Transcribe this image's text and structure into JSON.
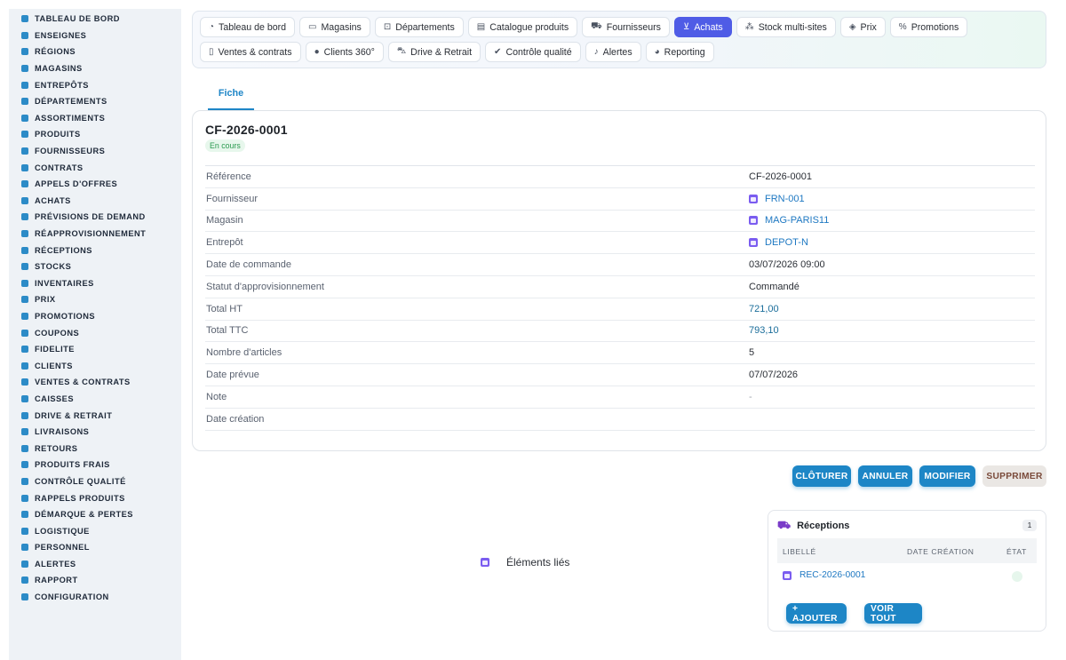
{
  "colors": {
    "accent": "#1d86c6",
    "active_nav": "#4f5ce6",
    "status_green": "#2a9a4f",
    "link": "#1e78c2"
  },
  "sidebar": {
    "items": [
      {
        "label": "TABLEAU DE BORD",
        "icon": "gauge-icon"
      },
      {
        "label": "ENSEIGNES",
        "icon": "flag-icon"
      },
      {
        "label": "RÉGIONS",
        "icon": "map-icon"
      },
      {
        "label": "MAGASINS",
        "icon": "store-icon"
      },
      {
        "label": "ENTREPÔTS",
        "icon": "warehouse-icon"
      },
      {
        "label": "DÉPARTEMENTS",
        "icon": "basket-icon"
      },
      {
        "label": "ASSORTIMENTS",
        "icon": "layers-icon"
      },
      {
        "label": "PRODUITS",
        "icon": "box-icon"
      },
      {
        "label": "FOURNISSEURS",
        "icon": "truck-icon"
      },
      {
        "label": "CONTRATS",
        "icon": "file-icon"
      },
      {
        "label": "APPELS D'OFFRES",
        "icon": "gavel-icon"
      },
      {
        "label": "ACHATS",
        "icon": "cart-icon"
      },
      {
        "label": "PRÉVISIONS DE DEMAND",
        "icon": "chart-icon"
      },
      {
        "label": "RÉAPPROVISIONNEMENT",
        "icon": "refresh-icon"
      },
      {
        "label": "RÉCEPTIONS",
        "icon": "dolly-icon"
      },
      {
        "label": "STOCKS",
        "icon": "cubes-icon"
      },
      {
        "label": "INVENTAIRES",
        "icon": "clipboard-icon"
      },
      {
        "label": "PRIX",
        "icon": "tag-icon"
      },
      {
        "label": "PROMOTIONS",
        "icon": "percent-icon"
      },
      {
        "label": "COUPONS",
        "icon": "ticket-icon"
      },
      {
        "label": "FIDELITE",
        "icon": "card-icon"
      },
      {
        "label": "CLIENTS",
        "icon": "user-icon"
      },
      {
        "label": "VENTES & CONTRATS",
        "icon": "handshake-icon"
      },
      {
        "label": "CAISSES",
        "icon": "register-icon"
      },
      {
        "label": "DRIVE & RETRAIT",
        "icon": "car-icon"
      },
      {
        "label": "LIVRAISONS",
        "icon": "delivery-icon"
      },
      {
        "label": "RETOURS",
        "icon": "undo-icon"
      },
      {
        "label": "PRODUITS FRAIS",
        "icon": "leaf-icon"
      },
      {
        "label": "CONTRÔLE QUALITÉ",
        "icon": "check-double-icon"
      },
      {
        "label": "RAPPELS PRODUITS",
        "icon": "warning-icon"
      },
      {
        "label": "DÉMARQUE & PERTES",
        "icon": "trash-icon"
      },
      {
        "label": "LOGISTIQUE",
        "icon": "route-icon"
      },
      {
        "label": "PERSONNEL",
        "icon": "users-icon"
      },
      {
        "label": "ALERTES",
        "icon": "bell-icon"
      },
      {
        "label": "RAPPORT",
        "icon": "pie-icon"
      },
      {
        "label": "CONFIGURATION",
        "icon": "cog-icon"
      }
    ]
  },
  "topnav": {
    "row1": [
      {
        "label": "Tableau de bord",
        "glyph": "◔",
        "active": false
      },
      {
        "label": "Magasins",
        "glyph": "▭",
        "active": false
      },
      {
        "label": "Départements",
        "glyph": "⊡",
        "active": false
      },
      {
        "label": "Catalogue produits",
        "glyph": "▤",
        "active": false
      },
      {
        "label": "Fournisseurs",
        "glyph": "⛟",
        "active": false
      },
      {
        "label": "Achats",
        "glyph": "⊻",
        "active": true
      },
      {
        "label": "Stock multi-sites",
        "glyph": "⁂",
        "active": false
      },
      {
        "label": "Prix",
        "glyph": "◈",
        "active": false
      },
      {
        "label": "Promotions",
        "glyph": "%",
        "active": false
      }
    ],
    "row2": [
      {
        "label": "Ventes & contrats",
        "glyph": "▯",
        "active": false
      },
      {
        "label": "Clients 360°",
        "glyph": "●",
        "active": false
      },
      {
        "label": "Drive & Retrait",
        "glyph": "⛍",
        "active": false
      },
      {
        "label": "Contrôle qualité",
        "glyph": "✔",
        "active": false
      },
      {
        "label": "Alertes",
        "glyph": "♪",
        "active": false
      },
      {
        "label": "Reporting",
        "glyph": "◕",
        "active": false
      }
    ]
  },
  "tabs": {
    "fiche": "Fiche"
  },
  "record": {
    "title": "CF-2026-0001",
    "status": "En cours",
    "fields": [
      {
        "label": "Référence",
        "value": "CF-2026-0001",
        "kind": "text"
      },
      {
        "label": "Fournisseur",
        "value": "FRN-001",
        "kind": "link"
      },
      {
        "label": "Magasin",
        "value": "MAG-PARIS11",
        "kind": "link"
      },
      {
        "label": "Entrepôt",
        "value": "DEPOT-N",
        "kind": "link"
      },
      {
        "label": "Date de commande",
        "value": "03/07/2026 09:00",
        "kind": "text"
      },
      {
        "label": "Statut d'approvisionnement",
        "value": "Commandé",
        "kind": "text"
      },
      {
        "label": "Total HT",
        "value": "721,00",
        "kind": "num"
      },
      {
        "label": "Total TTC",
        "value": "793,10",
        "kind": "num"
      },
      {
        "label": "Nombre d'articles",
        "value": "5",
        "kind": "text"
      },
      {
        "label": "Date prévue",
        "value": "07/07/2026",
        "kind": "text"
      },
      {
        "label": "Note",
        "value": "-",
        "kind": "muted"
      },
      {
        "label": "Date création",
        "value": "",
        "kind": "text"
      }
    ]
  },
  "actions": {
    "close": "CLÔTURER",
    "cancel": "ANNULER",
    "edit": "MODIFIER",
    "delete": "SUPPRIMER"
  },
  "related": {
    "title": "Éléments liés"
  },
  "receptions": {
    "title": "Réceptions",
    "count": "1",
    "columns": {
      "label": "LIBELLÉ",
      "date": "DATE CRÉATION",
      "state": "ÉTAT"
    },
    "rows": [
      {
        "label": "REC-2026-0001",
        "date": ""
      }
    ],
    "add": "+ AJOUTER",
    "view_all": "VOIR TOUT"
  }
}
